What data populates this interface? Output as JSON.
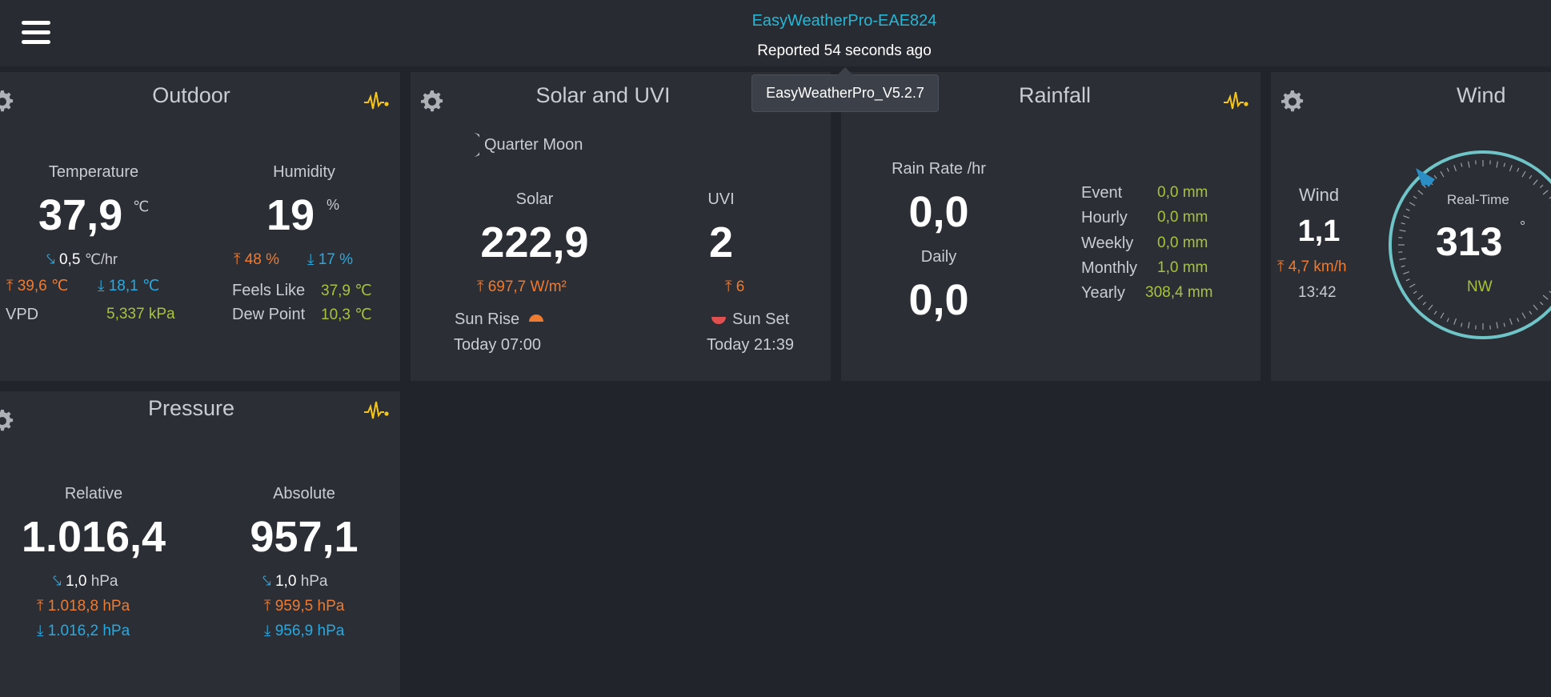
{
  "header": {
    "device_name": "EasyWeatherPro-EAE824",
    "reported": "Reported 54 seconds ago",
    "tooltip": "EasyWeatherPro_V5.2.7"
  },
  "outdoor": {
    "title": "Outdoor",
    "temperature_label": "Temperature",
    "temperature": "37,9",
    "temperature_unit": "℃",
    "trend_value": "0,5",
    "trend_unit": "℃/hr",
    "temp_high": "39,6 ℃",
    "temp_low": "18,1 ℃",
    "vpd_label": "VPD",
    "vpd": "5,337 kPa",
    "humidity_label": "Humidity",
    "humidity": "19",
    "humidity_unit": "%",
    "humidity_high": "48 %",
    "humidity_low": "17 %",
    "feels_like_label": "Feels Like",
    "feels_like": "37,9 ℃",
    "dew_point_label": "Dew Point",
    "dew_point": "10,3 ℃"
  },
  "solar": {
    "title": "Solar and UVI",
    "moon": "Quarter Moon",
    "solar_label": "Solar",
    "solar": "222,9",
    "solar_high": "697,7 W/m²",
    "uvi_label": "UVI",
    "uvi": "2",
    "uvi_high": "6",
    "sunrise_label": "Sun Rise",
    "sunrise": "Today 07:00",
    "sunset_label": "Sun Set",
    "sunset": "Today 21:39"
  },
  "rain": {
    "title": "Rainfall",
    "rate_label": "Rain Rate /hr",
    "rate": "0,0",
    "daily_label": "Daily",
    "daily": "0,0",
    "rows": [
      {
        "label": "Event",
        "value": "0,0 mm"
      },
      {
        "label": "Hourly",
        "value": "0,0 mm"
      },
      {
        "label": "Weekly",
        "value": "0,0 mm"
      },
      {
        "label": "Monthly",
        "value": "1,0 mm"
      },
      {
        "label": "Yearly",
        "value": "308,4 mm"
      }
    ]
  },
  "wind": {
    "title": "Wind",
    "wind_label": "Wind",
    "wind": "1,1",
    "gust": "4,7 km/h",
    "time": "13:42",
    "realtime_label": "Real-Time",
    "direction": "313",
    "direction_unit": "°",
    "compass": "NW"
  },
  "pressure": {
    "title": "Pressure",
    "relative_label": "Relative",
    "relative": "1.016,4",
    "rel_trend": "1,0",
    "rel_trend_unit": "hPa",
    "rel_high": "1.018,8 hPa",
    "rel_low": "1.016,2 hPa",
    "absolute_label": "Absolute",
    "absolute": "957,1",
    "abs_trend": "1,0",
    "abs_trend_unit": "hPa",
    "abs_high": "959,5 hPa",
    "abs_low": "956,9 hPa"
  },
  "colors": {
    "accent_blue": "#29b6d4",
    "high": "#ee7b30",
    "low": "#29a9e0",
    "value_green": "#a6c43a",
    "pulse": "#f5c518"
  }
}
